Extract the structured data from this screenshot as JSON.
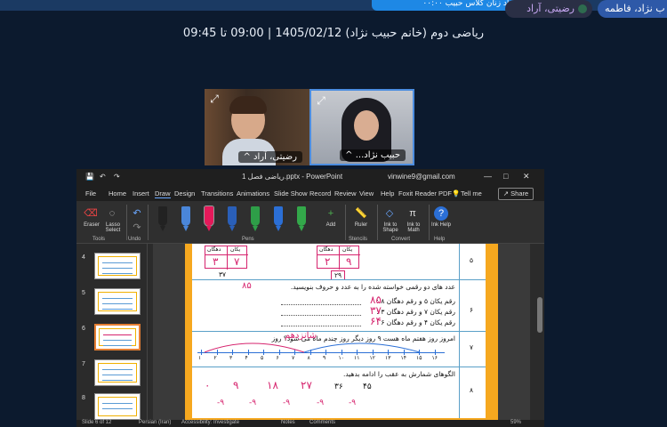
{
  "meeting": {
    "banner_text": "رشاد زنان کلاس حبیب ۰۰:۰۰",
    "session_title": "ریاضی دوم (خانم حبیب نژاد) 1405/02/12 | 09:00 تا 09:45",
    "participant_chips": [
      "ب نژاد، فاطمه",
      "رضیتی، آراد"
    ],
    "video_tiles": [
      {
        "name": "رضیتی، آراد ^",
        "expand_icon": "expand-icon"
      },
      {
        "name": "حبیب نژاد... ^",
        "expand_icon": "expand-icon"
      }
    ]
  },
  "ppt": {
    "title": "ریاضی فصل 1.pptx - PowerPoint",
    "account": "vinwine9@gmail.com",
    "quick_access": [
      "save-icon",
      "undo-icon",
      "redo-icon"
    ],
    "menu": [
      "File",
      "Home",
      "Insert",
      "Draw",
      "Design",
      "Transitions",
      "Animations",
      "Slide Show",
      "Record",
      "Review",
      "View",
      "Help",
      "Foxit Reader PDF",
      "Tell me"
    ],
    "share_label": "Share",
    "ribbon": {
      "eraser": "Eraser",
      "lasso": "Lasso Select",
      "tools_group": "Tools",
      "undo_group": "Undo",
      "add": "Add",
      "pens_group": "Pens",
      "ruler": "Ruler",
      "stencils_group": "Stencils",
      "ink_to_shape": "Ink to Shape",
      "ink_to_math": "Ink to Math",
      "convert_group": "Convert",
      "ink_help": "Ink Help",
      "help_group": "Help"
    },
    "pen_colors": [
      "#222222",
      "#4a86d9",
      "#e5195a",
      "#2a5fb8",
      "#2e9e48",
      "#2b6fd6",
      "#33a84a"
    ],
    "selected_pen": 2,
    "thumbnails": [
      "4",
      "5",
      "6",
      "7",
      "8"
    ],
    "selected_thumbnail": "6",
    "status": {
      "slide": "Slide 6 of 12",
      "language": "Persian (Iran)",
      "accessibility": "Accessibility: Investigate",
      "notes": "Notes",
      "comments": "Comments",
      "zoom": "59%"
    }
  },
  "worksheet": {
    "table_headers": [
      "یکان",
      "دهگان"
    ],
    "row5_values_left": [
      "۷",
      "۳"
    ],
    "row5_values_right": [
      "۹",
      "۲"
    ],
    "row5_sum_left": "۳۷",
    "row5_sum_right": "۲۹",
    "row_numbers": [
      "۵",
      "۶",
      "۷",
      "۸"
    ],
    "q6_title": "عدد های دو رقمی خواسته شده را به عدد و حروف بنویسید.",
    "q6_lines": [
      "رقم یکان ۵ و رقم دهگان ۸ :",
      "رقم یکان ۷ و رقم دهگان ۳ :",
      "رقم یکان ۴ و رقم دهگان ۶ :"
    ],
    "q6_answers": [
      "۸۵",
      "۳۷",
      "۶۴"
    ],
    "q6_fraction": "۸۵",
    "q7_text": "امروز روز هفتم ماه هست ۹ روز دیگر روز چندم ماه می شود؟ روز",
    "q7_answer": "شانزدهم",
    "number_line": [
      "۱",
      "۲",
      "۳",
      "۴",
      "۵",
      "۶",
      "۷",
      "۸",
      "۹",
      "۱۰",
      "۱۱",
      "۱۲",
      "۱۳",
      "۱۴",
      "۱۵",
      "۱۶"
    ],
    "q8_title": "الگوهای شمارش به عقب را ادامه بدهید.",
    "q8_printed": [
      "۴۵",
      "۳۶"
    ],
    "q8_handwritten": [
      "۲۷",
      "۱۸",
      "۹",
      "۰"
    ],
    "q8_steps": [
      "-۹",
      "-۹",
      "-۹",
      "-۹",
      "-۹"
    ]
  }
}
